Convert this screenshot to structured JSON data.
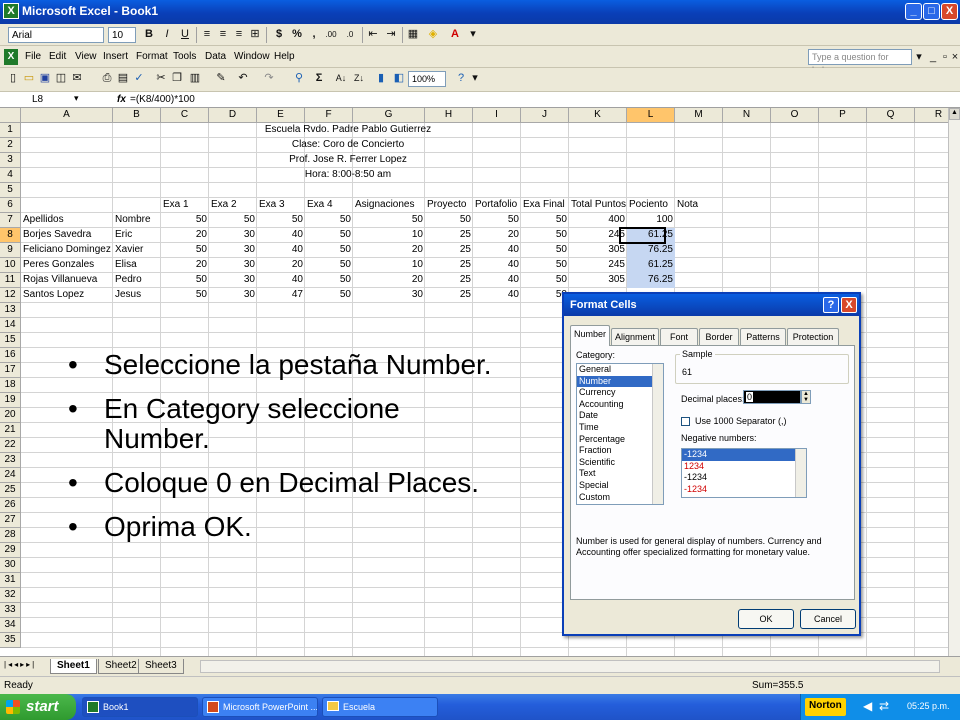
{
  "window": {
    "title": "Microsoft Excel - Book1",
    "controls": [
      "_",
      "□",
      "X"
    ]
  },
  "format_toolbar": {
    "font": "Arial",
    "size": "10",
    "bold": "B",
    "italic": "I",
    "underline": "U",
    "currency": "$",
    "percent": "%",
    "comma": ",",
    "inc_decimal": ".00",
    "dec_decimal": ".0"
  },
  "menu": {
    "items": [
      "File",
      "Edit",
      "View",
      "Insert",
      "Format",
      "Tools",
      "Data",
      "Window",
      "Help"
    ],
    "help_placeholder": "Type a question for help"
  },
  "standard_toolbar": {
    "zoom": "100%",
    "sigma": "Σ"
  },
  "formula_bar": {
    "name_box": "L8",
    "fx": "fx",
    "formula": "=(K8/400)*100"
  },
  "sheet": {
    "columns": [
      "A",
      "B",
      "C",
      "D",
      "E",
      "F",
      "G",
      "H",
      "I",
      "J",
      "K",
      "L",
      "M",
      "N",
      "O",
      "P",
      "Q",
      "R"
    ],
    "rows": [
      "1",
      "2",
      "3",
      "4",
      "5",
      "6",
      "7",
      "8",
      "9",
      "10",
      "11",
      "12",
      "13",
      "14",
      "15",
      "16",
      "17",
      "18",
      "19",
      "20",
      "21",
      "22",
      "23",
      "24",
      "25",
      "26",
      "27",
      "28",
      "29",
      "30",
      "31",
      "32",
      "33",
      "34",
      "35"
    ],
    "titles": [
      "Escuela Rvdo. Padre Pablo Gutierrez",
      "Clase: Coro de Concierto",
      "Prof. Jose R. Ferrer Lopez",
      "Hora: 8:00-8:50 am"
    ],
    "header_row": [
      "Exa 1",
      "Exa 2",
      "Exa 3",
      "Exa 4",
      "Asignaciones",
      "Proyecto",
      "Portafolio",
      "Exa Final",
      "Total Puntos",
      "Pociento",
      "Nota"
    ],
    "label_row": [
      "Apellidos",
      "Nombre",
      "50",
      "50",
      "50",
      "50",
      "50",
      "50",
      "50",
      "50",
      "400",
      "100"
    ],
    "students": [
      [
        "Borjes Savedra",
        "Eric",
        "20",
        "30",
        "40",
        "50",
        "10",
        "25",
        "20",
        "50",
        "245",
        "61.25"
      ],
      [
        "Feliciano Domingez",
        "Xavier",
        "50",
        "30",
        "40",
        "50",
        "20",
        "25",
        "40",
        "50",
        "305",
        "76.25"
      ],
      [
        "Peres Gonzales",
        "Elisa",
        "20",
        "30",
        "20",
        "50",
        "10",
        "25",
        "40",
        "50",
        "245",
        "61.25"
      ],
      [
        "Rojas Villanueva",
        "Pedro",
        "50",
        "30",
        "40",
        "50",
        "20",
        "25",
        "40",
        "50",
        "305",
        "76.25"
      ],
      [
        "Santos Lopez",
        "Jesus",
        "50",
        "30",
        "47",
        "50",
        "30",
        "25",
        "40",
        "50",
        "",
        ""
      ]
    ]
  },
  "sheet_tabs": [
    "Sheet1",
    "Sheet2",
    "Sheet3"
  ],
  "status": {
    "ready": "Ready",
    "sum": "Sum=355.5"
  },
  "taskbar": {
    "start": "start",
    "tasks": [
      "Book1",
      "Microsoft PowerPoint ...",
      "Escuela"
    ],
    "norton": "Norton",
    "clock": "05:25 p.m."
  },
  "slide": {
    "bullets": [
      "Seleccione la pestaña Number.",
      "En Category seleccione Number.",
      "Coloque 0 en Decimal Places.",
      "Oprima OK."
    ]
  },
  "dialog": {
    "title": "Format Cells",
    "help": "?",
    "close": "X",
    "tabs": [
      "Number",
      "Alignment",
      "Font",
      "Border",
      "Patterns",
      "Protection"
    ],
    "category_label": "Category:",
    "categories": [
      "General",
      "Number",
      "Currency",
      "Accounting",
      "Date",
      "Time",
      "Percentage",
      "Fraction",
      "Scientific",
      "Text",
      "Special",
      "Custom"
    ],
    "sample_label": "Sample",
    "sample_value": "61",
    "decimal_label": "Decimal places:",
    "decimal_value": "0",
    "separator_label": "Use 1000 Separator (,)",
    "negative_label": "Negative numbers:",
    "negatives": [
      "-1234",
      "1234",
      "-1234",
      "-1234"
    ],
    "description": "Number is used for general display of numbers. Currency and Accounting offer specialized formatting for monetary value.",
    "ok": "OK",
    "cancel": "Cancel"
  }
}
